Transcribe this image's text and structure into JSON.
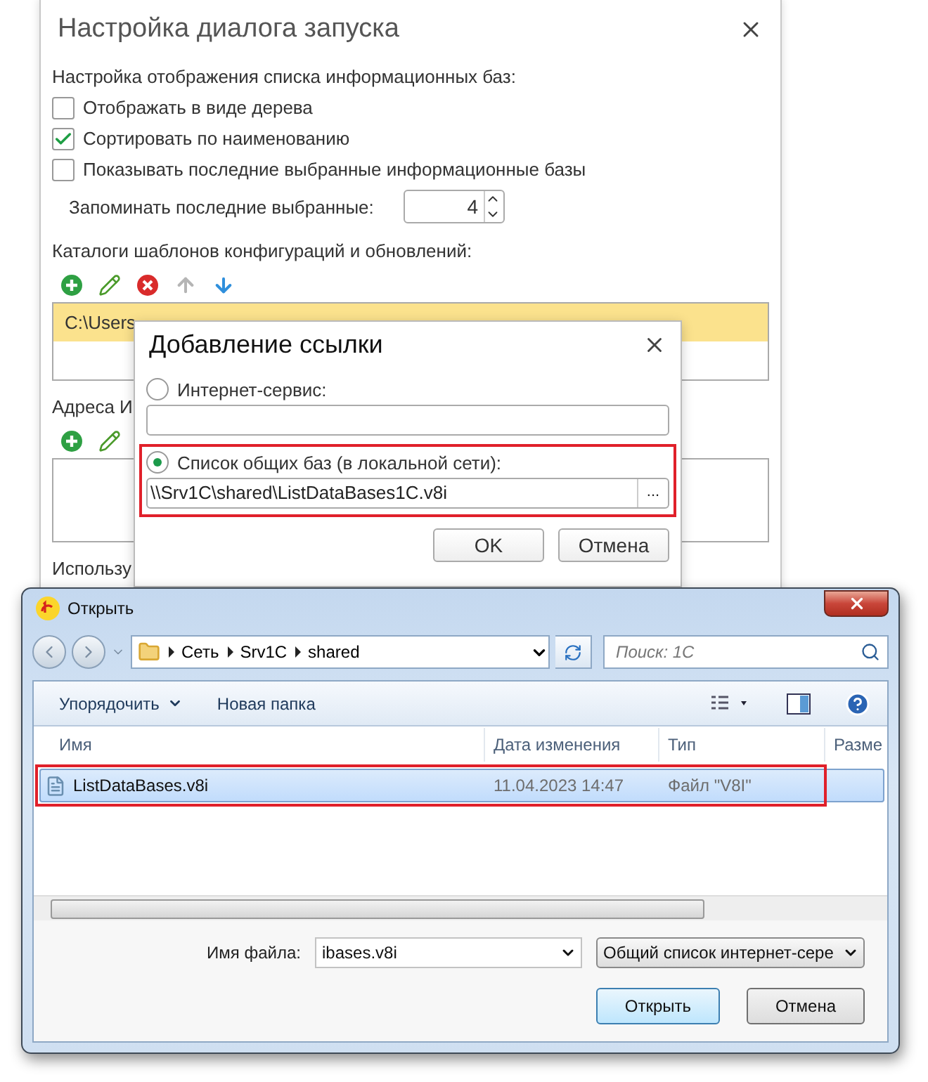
{
  "settings_window": {
    "title": "Настройка диалога запуска",
    "section_label": "Настройка отображения списка информационных баз:",
    "checkboxes": [
      {
        "label": "Отображать в виде дерева",
        "checked": false
      },
      {
        "label": "Сортировать по наименованию",
        "checked": true
      },
      {
        "label": "Показывать последние выбранные информационные базы",
        "checked": false
      }
    ],
    "remember": {
      "label": "Запоминать последние выбранные:",
      "value": "4"
    },
    "catalogs": {
      "label": "Каталоги шаблонов конфигураций и обновлений:",
      "rows": [
        {
          "text": "C:\\Users",
          "selected": true
        }
      ]
    },
    "addresses": {
      "label": "Адреса И"
    },
    "footer_label": "Использу"
  },
  "add_link_dialog": {
    "title": "Добавление ссылки",
    "options": [
      {
        "label": "Интернет-сервис:",
        "selected": false,
        "highlighted": false
      },
      {
        "label": "Список общих баз (в локальной сети):",
        "selected": true,
        "highlighted": true,
        "value": "\\\\Srv1C\\shared\\ListDataBases1C.v8i",
        "browse": "..."
      }
    ],
    "buttons": [
      "OK",
      "Отмена"
    ]
  },
  "open_dialog": {
    "title": "Открыть",
    "path": [
      "Сеть",
      "Srv1C",
      "shared"
    ],
    "search_placeholder": "Поиск: 1C",
    "organize": "Упорядочить",
    "new_folder": "Новая папка",
    "columns": [
      "Имя",
      "Дата изменения",
      "Тип",
      "Разме"
    ],
    "files": [
      {
        "name": "ListDataBases.v8i",
        "modified": "11.04.2023 14:47",
        "type": "Файл \"V8I\"",
        "selected": true,
        "highlighted": true
      }
    ],
    "file_name_label": "Имя файла:",
    "file_name": "ibases.v8i",
    "file_type": "Общий список интернет-сере",
    "buttons": [
      {
        "label": "Открыть",
        "default": true
      },
      {
        "label": "Отмена",
        "default": false
      }
    ]
  }
}
